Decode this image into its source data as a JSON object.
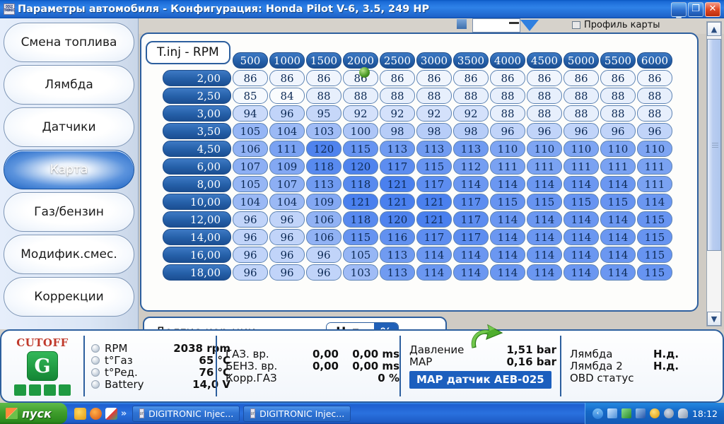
{
  "window": {
    "title": "Параметры автомобиля - Конфигурация: Honda Pilot V-6, 3.5, 249 HP",
    "icon": "app-icon",
    "minimize": "_",
    "maximize": "❐",
    "close": "✕"
  },
  "sidebar": {
    "items": [
      {
        "label": "Смена топлива",
        "active": false
      },
      {
        "label": "Лямбда",
        "active": false
      },
      {
        "label": "Датчики",
        "active": false
      },
      {
        "label": "Карта",
        "active": true
      },
      {
        "label": "Газ/бензин",
        "active": false
      },
      {
        "label": "Модифик.смес.",
        "active": false
      },
      {
        "label": "Коррекции",
        "active": false
      }
    ]
  },
  "topstrip": {
    "profile_label": "Профиль карты"
  },
  "map_panel": {
    "tab_title": "T.inj - RPM"
  },
  "chart_data": {
    "type": "table",
    "title": "T.inj - RPM",
    "xlabel": "RPM",
    "ylabel": "T.inj",
    "categories": [
      "500",
      "1000",
      "1500",
      "2000",
      "2500",
      "3000",
      "3500",
      "4000",
      "4500",
      "5000",
      "5500",
      "6000"
    ],
    "row_labels": [
      "2,00",
      "2,50",
      "3,00",
      "3,50",
      "4,50",
      "6,00",
      "8,00",
      "10,00",
      "12,00",
      "14,00",
      "16,00",
      "18,00"
    ],
    "values": [
      [
        86,
        86,
        86,
        86,
        86,
        86,
        86,
        86,
        86,
        86,
        86,
        86
      ],
      [
        85,
        84,
        88,
        88,
        88,
        88,
        88,
        88,
        88,
        88,
        88,
        88
      ],
      [
        94,
        96,
        95,
        92,
        92,
        92,
        92,
        88,
        88,
        88,
        88,
        88
      ],
      [
        105,
        104,
        103,
        100,
        98,
        98,
        98,
        96,
        96,
        96,
        96,
        96
      ],
      [
        106,
        111,
        120,
        115,
        113,
        113,
        113,
        110,
        110,
        110,
        110,
        110
      ],
      [
        107,
        109,
        118,
        120,
        117,
        115,
        112,
        111,
        111,
        111,
        111,
        111
      ],
      [
        105,
        107,
        113,
        118,
        121,
        117,
        114,
        114,
        114,
        114,
        114,
        111
      ],
      [
        104,
        104,
        109,
        121,
        121,
        121,
        117,
        115,
        115,
        115,
        115,
        114
      ],
      [
        96,
        96,
        106,
        118,
        120,
        121,
        117,
        114,
        114,
        114,
        114,
        115
      ],
      [
        96,
        96,
        106,
        115,
        116,
        117,
        117,
        114,
        114,
        114,
        114,
        115
      ],
      [
        96,
        96,
        96,
        105,
        113,
        114,
        114,
        114,
        114,
        114,
        114,
        115
      ],
      [
        96,
        96,
        96,
        103,
        113,
        114,
        114,
        114,
        114,
        114,
        114,
        115
      ]
    ],
    "vmin": 84,
    "vmax": 121
  },
  "long_corrections": {
    "label": "Долгие кор-ции",
    "value": "Н.д.",
    "unit": "%"
  },
  "dashboard": {
    "cutoff": {
      "title": "CUTOFF",
      "letter": "G",
      "bars": 4
    },
    "engine": [
      {
        "label": "RPM",
        "value": "2038 rpm"
      },
      {
        "label": "t°Газ",
        "value": "65 °C"
      },
      {
        "label": "t°Ред.",
        "value": "76 °C"
      },
      {
        "label": "Battery",
        "value": "14,0 V"
      }
    ],
    "injection": [
      {
        "label": "ГАЗ. вр.",
        "value1": "0,00",
        "value2": "0,00 ms"
      },
      {
        "label": "БЕНЗ. вр.",
        "value1": "0,00",
        "value2": "0,00 ms"
      },
      {
        "label": "Корр.ГАЗ",
        "value1": "",
        "value2": "0 %"
      }
    ],
    "pressure": [
      {
        "label": "Давление",
        "value": "1,51 bar"
      },
      {
        "label": "MAP",
        "value": "0,16 bar"
      }
    ],
    "map_sensor": "MAP датчик AEB-025",
    "lambda": [
      {
        "label": "Лямбда",
        "value": "Н.д."
      },
      {
        "label": "Лямбда 2",
        "value": "Н.д."
      },
      {
        "label": "OBD статус",
        "value": ""
      }
    ]
  },
  "taskbar": {
    "start": "пуск",
    "overflow_chevron": "»",
    "tasks": [
      {
        "label": "DIGITRONIC Injec..."
      },
      {
        "label": "DIGITRONIC Injec..."
      }
    ],
    "clock": "18:12",
    "tray_chevron": "‹"
  }
}
